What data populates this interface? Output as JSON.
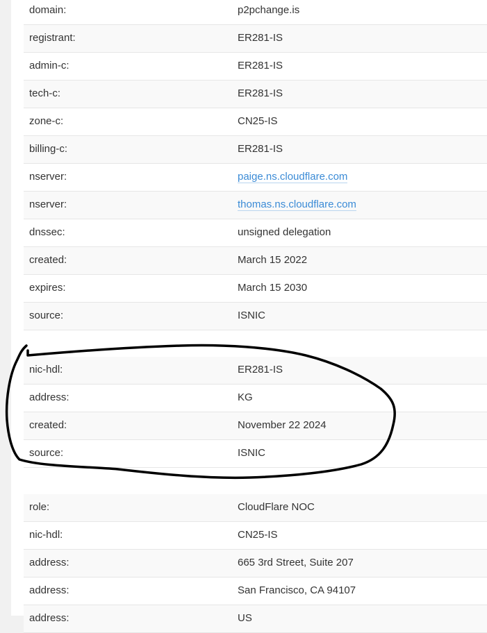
{
  "domain_block": [
    {
      "key": "domain:",
      "value": "p2pchange.is"
    },
    {
      "key": "registrant:",
      "value": "ER281-IS"
    },
    {
      "key": "admin-c:",
      "value": "ER281-IS"
    },
    {
      "key": "tech-c:",
      "value": "ER281-IS"
    },
    {
      "key": "zone-c:",
      "value": "CN25-IS"
    },
    {
      "key": "billing-c:",
      "value": "ER281-IS"
    },
    {
      "key": "nserver:",
      "value": "paige.ns.cloudflare.com"
    },
    {
      "key": "nserver:",
      "value": "thomas.ns.cloudflare.com"
    },
    {
      "key": "dnssec:",
      "value": "unsigned delegation"
    },
    {
      "key": "created:",
      "value": "March 15 2022"
    },
    {
      "key": "expires:",
      "value": "March 15 2030"
    },
    {
      "key": "source:",
      "value": "ISNIC"
    }
  ],
  "contact_block": [
    {
      "key": "nic-hdl:",
      "value": "ER281-IS"
    },
    {
      "key": "address:",
      "value": "KG"
    },
    {
      "key": "created:",
      "value": "November 22 2024"
    },
    {
      "key": "source:",
      "value": "ISNIC"
    }
  ],
  "role_block": [
    {
      "key": "role:",
      "value": "CloudFlare NOC"
    },
    {
      "key": "nic-hdl:",
      "value": "CN25-IS"
    },
    {
      "key": "address:",
      "value": "665 3rd Street, Suite 207"
    },
    {
      "key": "address:",
      "value": "San Francisco, CA 94107"
    },
    {
      "key": "address:",
      "value": "US"
    }
  ],
  "colors": {
    "link": "#3b8bd6",
    "annotation": "#000000"
  }
}
